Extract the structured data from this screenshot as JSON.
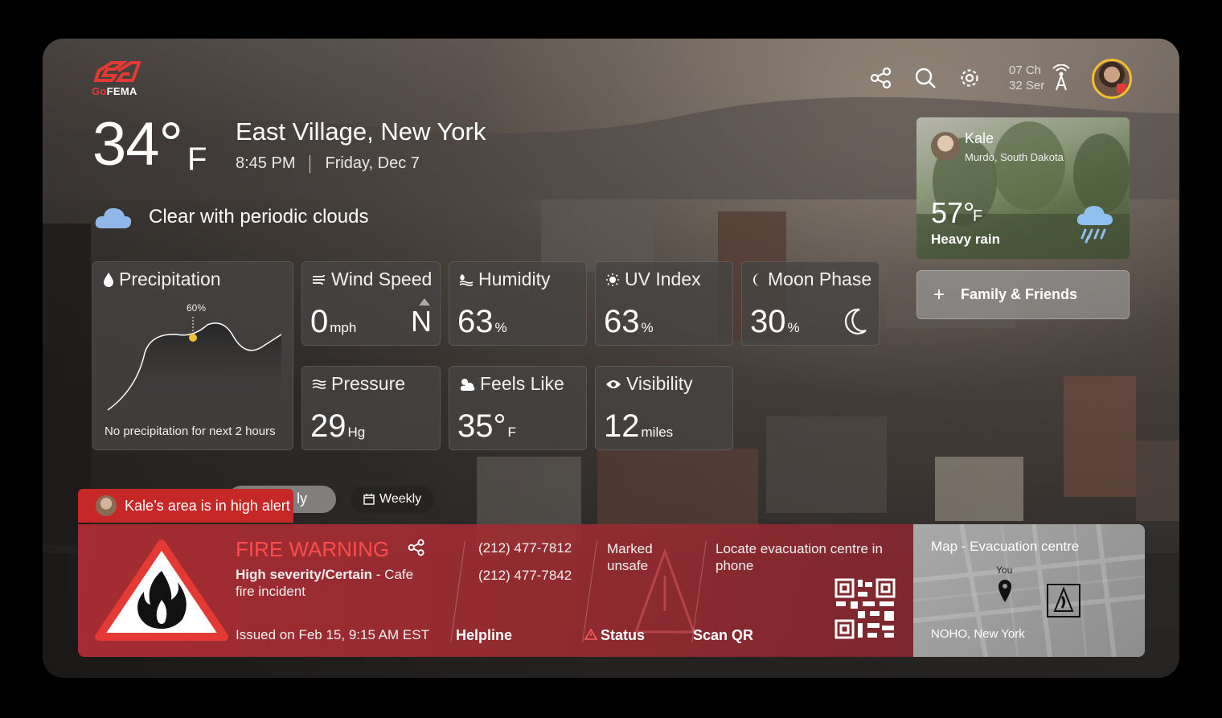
{
  "app": {
    "logo_text_go": "Go",
    "logo_text_rest": "FEMA"
  },
  "header": {
    "channel": "07 Ch",
    "series": "32 Ser"
  },
  "current": {
    "temperature": "34°",
    "unit": "F",
    "location": "East Village, New York",
    "time": "8:45 PM",
    "date": "Friday, Dec 7",
    "condition": "Clear with periodic clouds"
  },
  "precipitation": {
    "title": "Precipitation",
    "peak_label": "60%",
    "note": "No precipitation for next 2 hours"
  },
  "metrics": {
    "wind": {
      "title": "Wind Speed",
      "value": "0",
      "unit": "mph",
      "direction": "N"
    },
    "humidity": {
      "title": "Humidity",
      "value": "63",
      "unit": "%"
    },
    "uv": {
      "title": "UV Index",
      "value": "63",
      "unit": "%"
    },
    "moon": {
      "title": "Moon Phase",
      "value": "30",
      "unit": "%"
    },
    "pressure": {
      "title": "Pressure",
      "value": "29",
      "unit": "Hg"
    },
    "feels": {
      "title": "Feels Like",
      "value": "35°",
      "unit": "F"
    },
    "visibility": {
      "title": "Visibility",
      "value": "12",
      "unit": "miles"
    }
  },
  "tabs": {
    "hourly_partial": "ly",
    "weekly": "Weekly"
  },
  "friend": {
    "name": "Kale",
    "location": "Murdo, South Dakota",
    "temperature": "57°",
    "unit": "F",
    "condition": "Heavy rain"
  },
  "family_button": "Family & Friends",
  "alert": {
    "flag": "Kale’s area is in high alert",
    "title": "FIRE WARNING",
    "severity": "High severity/Certain",
    "desc": " - Cafe fire incident",
    "issued": "Issued on Feb 15, 9:15 AM EST",
    "phone1": "(212) 477-7812",
    "phone2": "(212) 477-7842",
    "helpline_label": "Helpline",
    "marked": "Marked unsafe",
    "status_label": "Status",
    "locate": "Locate evacuation centre in phone",
    "scan_label": "Scan QR"
  },
  "map": {
    "title": "Map - Evacuation centre",
    "you_label": "You",
    "place": "NOHO, New York"
  },
  "colors": {
    "alert_red": "#c62828",
    "warning_title": "#ff4d4d",
    "accent_yellow": "#f0c030"
  }
}
